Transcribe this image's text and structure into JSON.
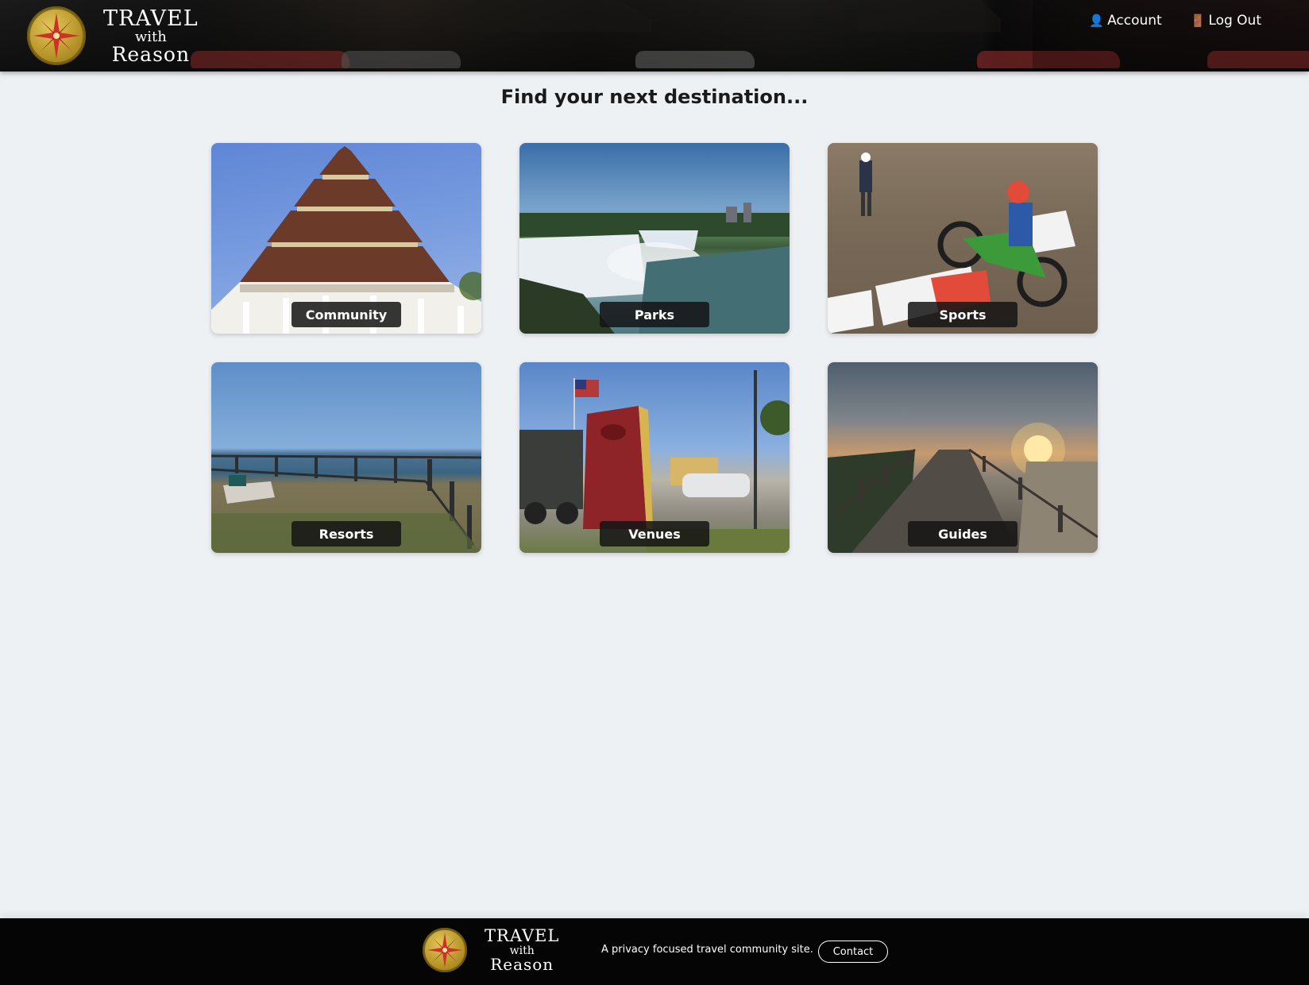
{
  "header": {
    "logo": {
      "line1": "TRAVEL",
      "line2": "with",
      "line3": "Reason"
    },
    "nav": [
      {
        "label": "Account",
        "icon": "user-icon"
      },
      {
        "label": "Log Out",
        "icon": "door-icon"
      }
    ]
  },
  "main": {
    "headline": "Find your next destination...",
    "cards": [
      {
        "label": "Community",
        "image": "pagoda"
      },
      {
        "label": "Parks",
        "image": "waterfall"
      },
      {
        "label": "Sports",
        "image": "motocross"
      },
      {
        "label": "Resorts",
        "image": "waterfront-railing"
      },
      {
        "label": "Venues",
        "image": "entrance-sign"
      },
      {
        "label": "Guides",
        "image": "boardwalk-sunset"
      }
    ]
  },
  "footer": {
    "logo": {
      "line1": "TRAVEL",
      "line2": "with",
      "line3": "Reason"
    },
    "tagline": "A privacy focused travel community site.",
    "contact_label": "Contact"
  },
  "colors": {
    "background": "#eef1f4",
    "footer": "#050505",
    "label_bg": "#141414",
    "compass_gold": "#c9a93a",
    "compass_red": "#d0302a"
  }
}
